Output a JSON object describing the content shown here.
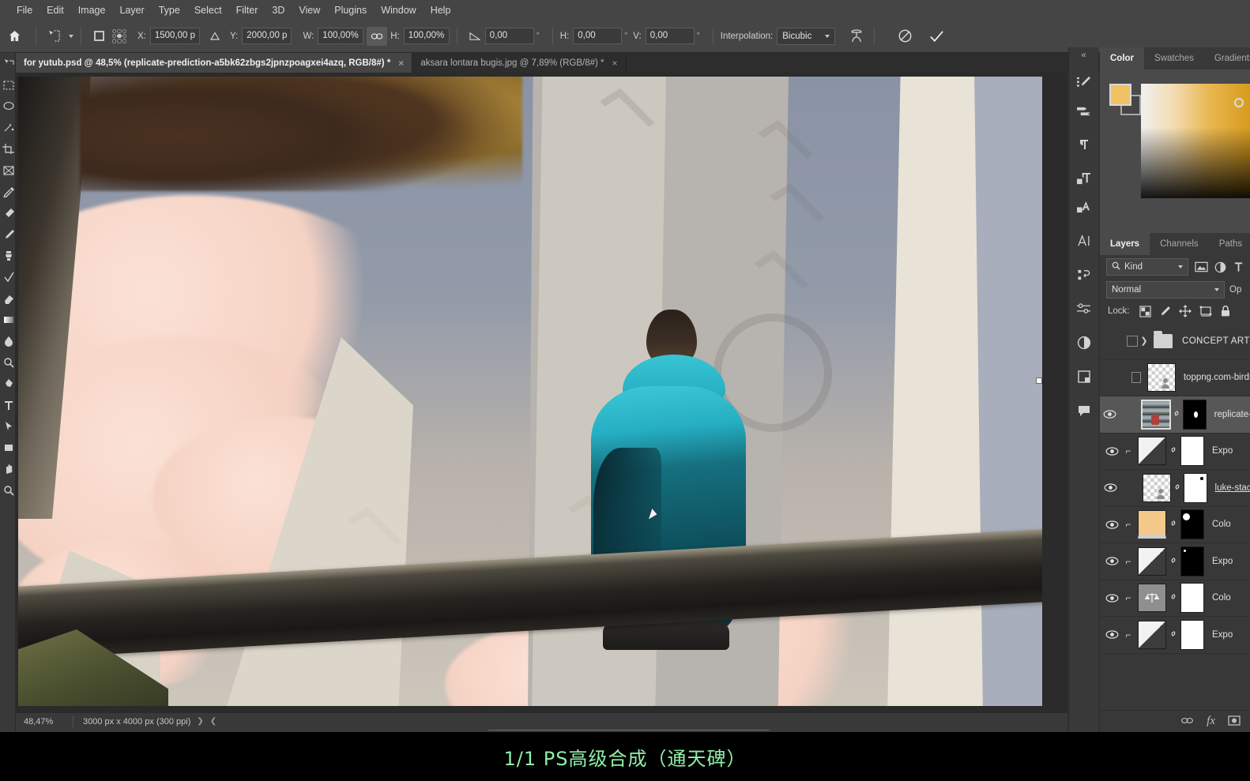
{
  "menubar": {
    "items": [
      "File",
      "Edit",
      "Image",
      "Layer",
      "Type",
      "Select",
      "Filter",
      "3D",
      "View",
      "Plugins",
      "Window",
      "Help"
    ]
  },
  "options_bar": {
    "home_icon": "home-icon",
    "tool_icon": "move-tool-icon",
    "x_label": "X:",
    "x_value": "1500,00 p",
    "y_label": "Y:",
    "y_value": "2000,00 p",
    "w_label": "W:",
    "w_value": "100,00%",
    "h_label": "H:",
    "h_value": "100,00%",
    "link_icon": "link-wh-icon",
    "angle_value": "0,00",
    "angle_unit": "°",
    "skew_h_label": "H:",
    "skew_h_value": "0,00",
    "skew_h_unit": "°",
    "skew_v_label": "V:",
    "skew_v_value": "0,00",
    "skew_v_unit": "°",
    "interpolation_label": "Interpolation:",
    "interpolation_value": "Bicubic",
    "warp_icon": "warp-icon",
    "cancel_icon": "cancel-transform-icon",
    "commit_icon": "commit-transform-icon"
  },
  "tabs": [
    {
      "title": "for yutub.psd @ 48,5% (replicate-prediction-a5bk62zbgs2jpnzpoagxei4azq, RGB/8#) *",
      "active": true,
      "close": "×"
    },
    {
      "title": "aksara lontara bugis.jpg @ 7,89% (RGB/8#) *",
      "active": false,
      "close": "×"
    }
  ],
  "status_bar": {
    "zoom": "48,47%",
    "doc_size": "3000 px x 4000 px (300 ppi)",
    "arrow_right": "❯",
    "arrow_left": "❮"
  },
  "color_panel": {
    "tabs": [
      {
        "label": "Color",
        "active": true
      },
      {
        "label": "Swatches",
        "active": false
      },
      {
        "label": "Gradients",
        "active": false
      }
    ],
    "foreground_color": "#f0c264",
    "background_color": "#454545"
  },
  "layers_panel": {
    "tabs": [
      {
        "label": "Layers",
        "active": true
      },
      {
        "label": "Channels",
        "active": false
      },
      {
        "label": "Paths",
        "active": false
      }
    ],
    "filter": {
      "kind_label": "Kind",
      "search_icon": "search-icon",
      "pixel_filter_icon": "pixel-layer-icon",
      "adjustment_filter_icon": "adjustment-layer-icon"
    },
    "blend_mode": "Normal",
    "opacity_label": "Op",
    "lock_label": "Lock:",
    "lock_icons": [
      "lock-transparency-icon",
      "lock-image-icon",
      "lock-position-icon",
      "lock-artboard-icon",
      "lock-all-icon"
    ],
    "rows": [
      {
        "type": "group",
        "name": "CONCEPT ART",
        "visible": false,
        "selected": false,
        "expand": "❯"
      },
      {
        "type": "pixel",
        "name": "toppng.com-birds-p",
        "visible": false,
        "selected": false,
        "clipped": false,
        "mask": false
      },
      {
        "type": "photo",
        "name": "replicate-p",
        "visible": true,
        "selected": true,
        "clipped": false,
        "mask": "black"
      },
      {
        "type": "adj",
        "name": "Expo",
        "visible": true,
        "selected": false,
        "clipped": true,
        "mask": "white"
      },
      {
        "type": "pixel",
        "name": "luke-stack",
        "visible": true,
        "selected": false,
        "clipped": false,
        "mask": "white",
        "underline": true
      },
      {
        "type": "color",
        "name": "Colo",
        "visible": true,
        "selected": false,
        "clipped": true,
        "mask": "black"
      },
      {
        "type": "adj",
        "name": "Expo",
        "visible": true,
        "selected": false,
        "clipped": true,
        "mask": "black"
      },
      {
        "type": "adj2",
        "name": "Colo",
        "visible": true,
        "selected": false,
        "clipped": true,
        "mask": "white"
      },
      {
        "type": "adj",
        "name": "Expo",
        "visible": true,
        "selected": false,
        "clipped": true,
        "mask": "white"
      }
    ],
    "footer_icons": [
      "link-layers-icon",
      "fx-icon",
      "add-mask-icon"
    ]
  },
  "dock_strip": {
    "collapse_icon": "collapse-panels-icon",
    "icons": [
      "brush-presets-icon",
      "brush-settings-icon",
      "paragraph-icon",
      "paragraph-styles-icon",
      "character-styles-icon",
      "character-icon",
      "actions-icon",
      "adjustments-icon",
      "properties-icon",
      "libraries-icon",
      "comments-icon"
    ]
  },
  "toolbar": {
    "tools": [
      "move-tool",
      "marquee-tool",
      "lasso-tool",
      "quick-select-tool",
      "crop-tool",
      "frame-tool",
      "eyedropper-tool",
      "healing-brush-tool",
      "brush-tool",
      "clone-stamp-tool",
      "history-brush-tool",
      "eraser-tool",
      "gradient-tool",
      "blur-tool",
      "dodge-tool",
      "pen-tool",
      "type-tool",
      "path-select-tool",
      "shape-tool",
      "hand-tool",
      "zoom-tool"
    ]
  },
  "subtitle": {
    "text": "1/1 PS高级合成（通天碑）",
    "color": "#8ef0a8"
  },
  "canvas": {
    "document_name": "for yutub.psd",
    "zoom": "48,47%",
    "cursor_icon": "arrow-cursor-icon",
    "transform_handle": "transform-handle"
  }
}
